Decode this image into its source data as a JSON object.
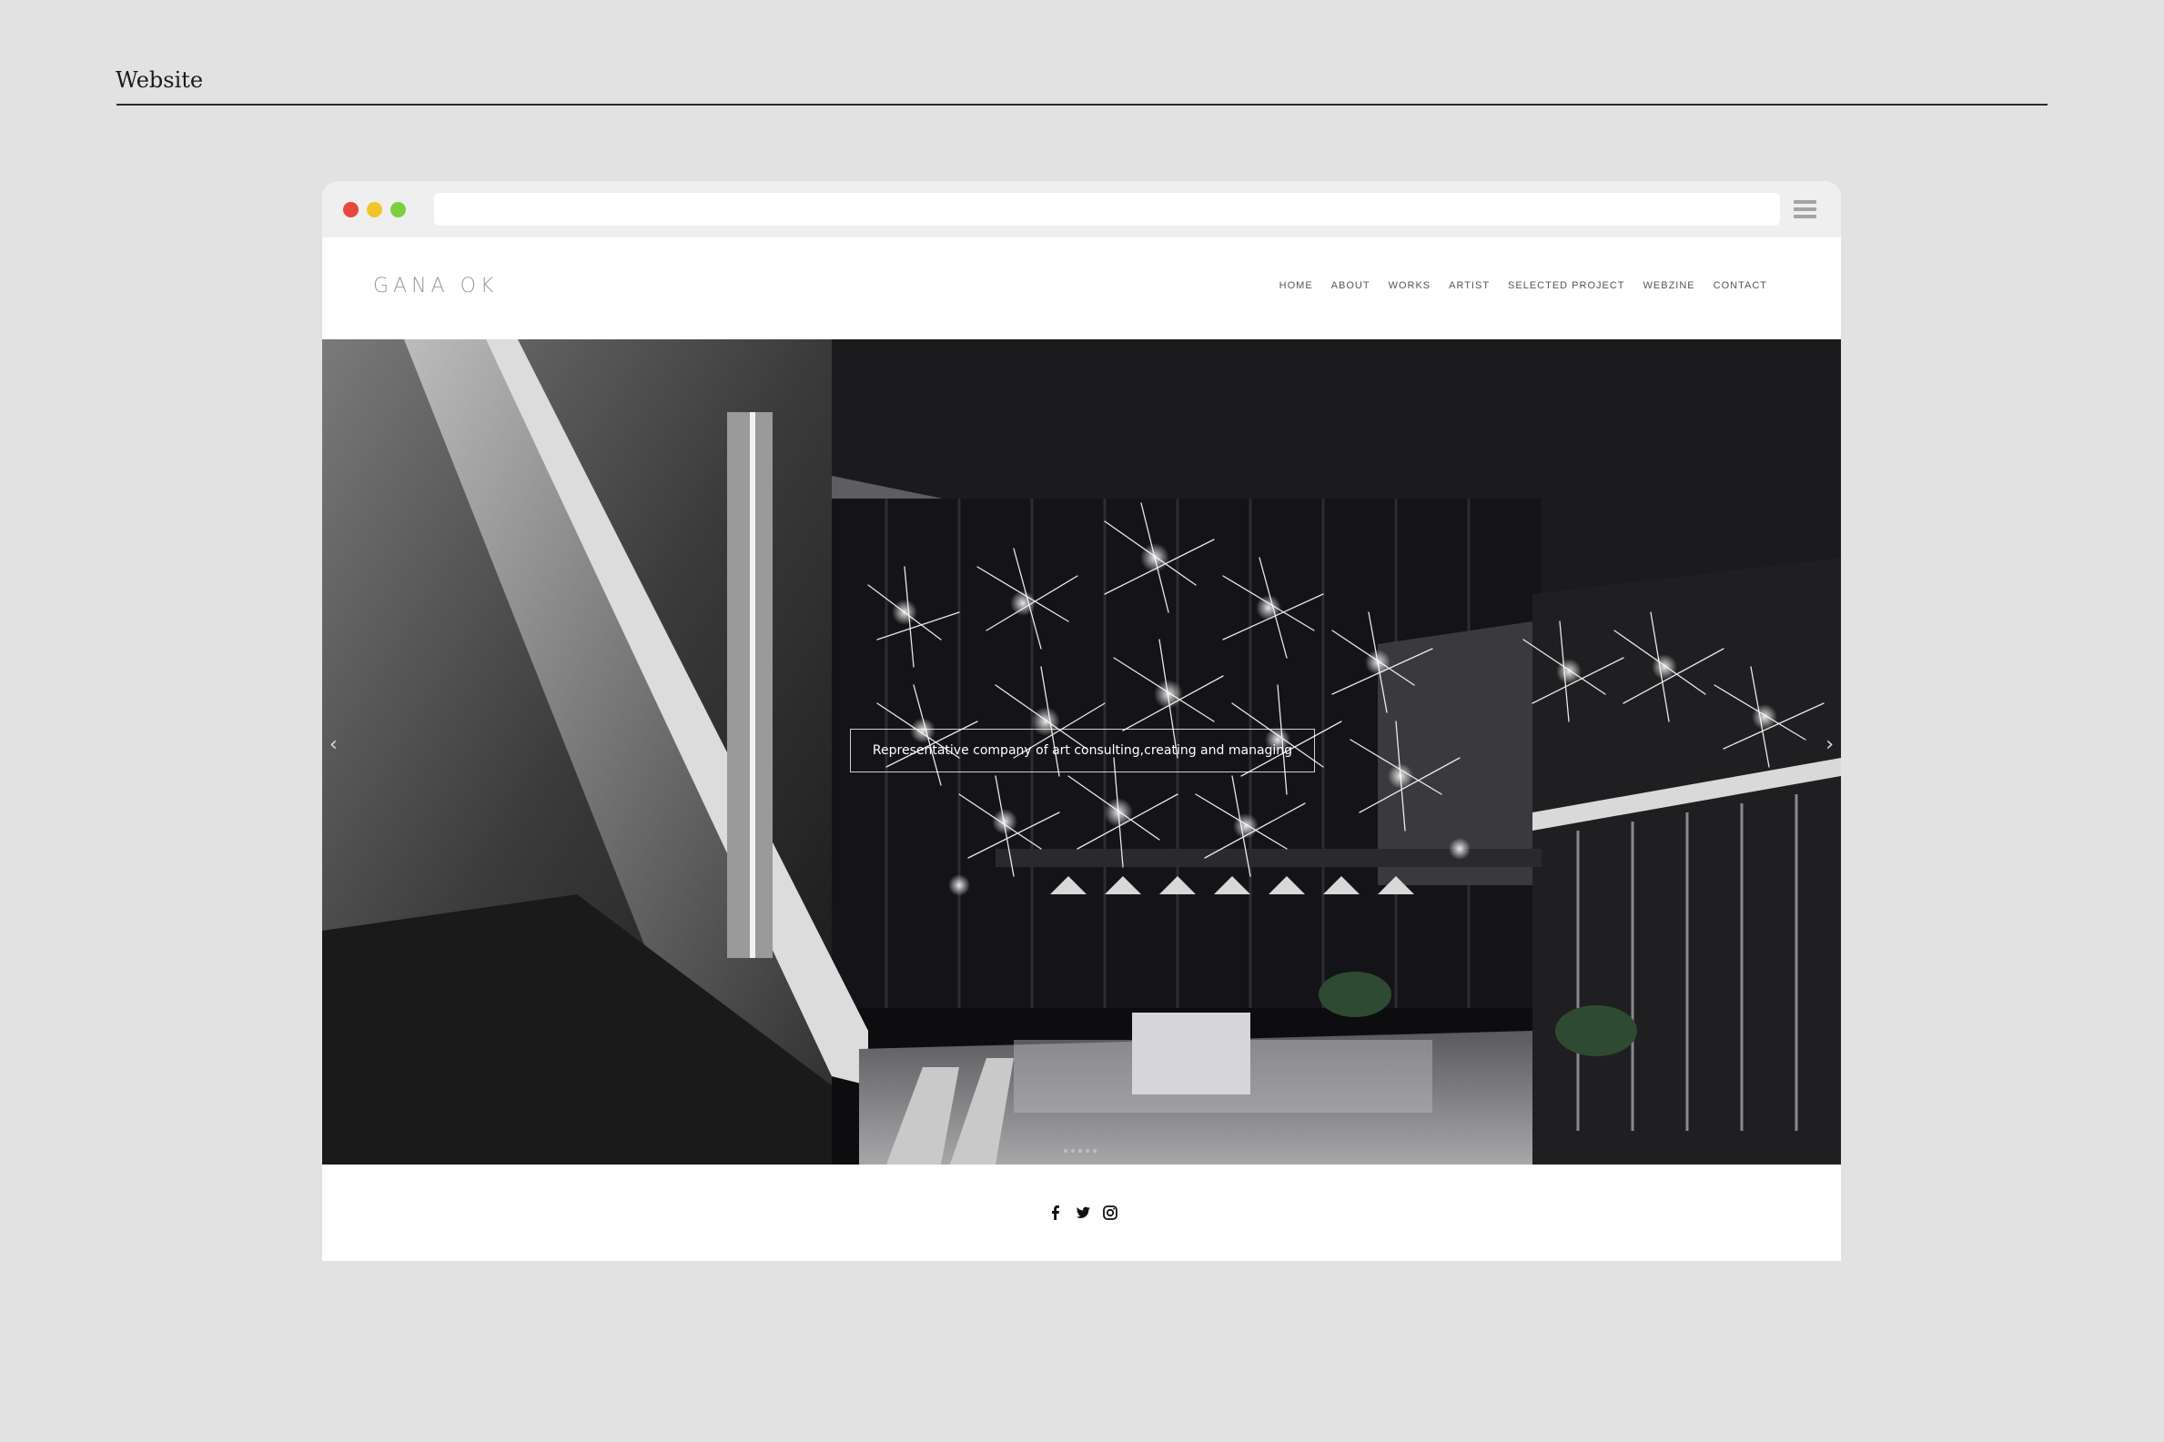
{
  "page": {
    "section_title": "Website"
  },
  "site": {
    "logo": "GANA OK",
    "nav": [
      "HOME",
      "ABOUT",
      "WORKS",
      "ARTIST",
      "SELECTED PROJECT",
      "WEBZINE",
      "CONTACT"
    ],
    "hero_caption": "Representative company of art consulting,creating and managing",
    "slider": {
      "prev": "‹",
      "next": "›",
      "slides": 5
    },
    "social_icons": [
      "facebook-icon",
      "twitter-icon",
      "instagram-icon"
    ]
  },
  "colors": {
    "background": "#e2e2e2",
    "chrome": "#efefef",
    "traffic_red": "#e9473b",
    "traffic_yellow": "#f4c32a",
    "traffic_green": "#7ccf3f"
  }
}
